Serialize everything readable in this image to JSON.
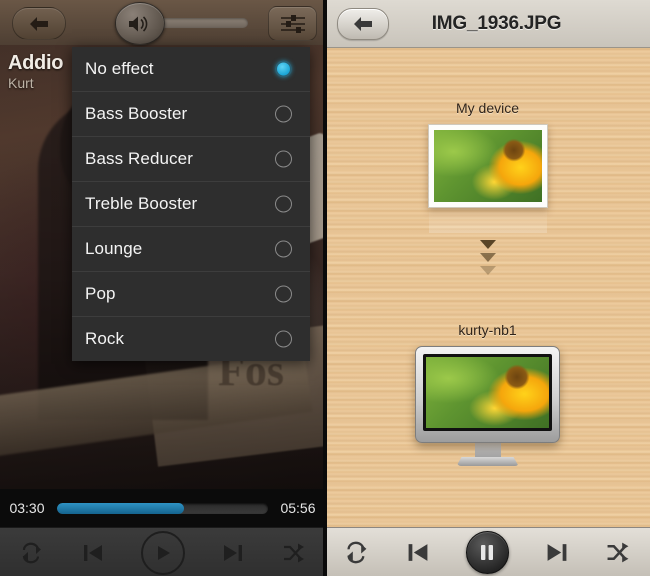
{
  "left_panel": {
    "top_bar": {
      "back_icon": "back-arrow-icon",
      "volume_icon": "speaker-volume-icon",
      "volume_level": 0,
      "equalizer_icon": "equalizer-sliders-icon"
    },
    "now_playing": {
      "title": "Addio",
      "artist": "Kurt"
    },
    "effects_menu": {
      "items": [
        {
          "label": "No effect",
          "selected": true
        },
        {
          "label": "Bass Booster",
          "selected": false
        },
        {
          "label": "Bass Reducer",
          "selected": false
        },
        {
          "label": "Treble Booster",
          "selected": false
        },
        {
          "label": "Lounge",
          "selected": false
        },
        {
          "label": "Pop",
          "selected": false
        },
        {
          "label": "Rock",
          "selected": false
        }
      ],
      "selected_color": "#1ba5d6"
    },
    "seek": {
      "elapsed": "03:30",
      "total": "05:56",
      "progress_percent": 60,
      "fill_color": "#2e93c4"
    },
    "controls": [
      {
        "name": "repeat-icon",
        "label": "Repeat"
      },
      {
        "name": "previous-icon",
        "label": "Previous"
      },
      {
        "name": "play-icon",
        "label": "Play"
      },
      {
        "name": "next-icon",
        "label": "Next"
      },
      {
        "name": "shuffle-icon",
        "label": "Shuffle"
      }
    ]
  },
  "right_panel": {
    "top_bar": {
      "back_icon": "back-arrow-icon",
      "title": "IMG_1936.JPG"
    },
    "source_device": {
      "label": "My device",
      "type": "photo-frame"
    },
    "flow_arrows": 3,
    "target_device": {
      "label": "kurty-nb1",
      "type": "monitor"
    },
    "controls": [
      {
        "name": "repeat-icon",
        "label": "Repeat"
      },
      {
        "name": "previous-icon",
        "label": "Previous"
      },
      {
        "name": "pause-icon",
        "label": "Pause"
      },
      {
        "name": "next-icon",
        "label": "Next"
      },
      {
        "name": "shuffle-icon",
        "label": "Shuffle"
      }
    ]
  }
}
